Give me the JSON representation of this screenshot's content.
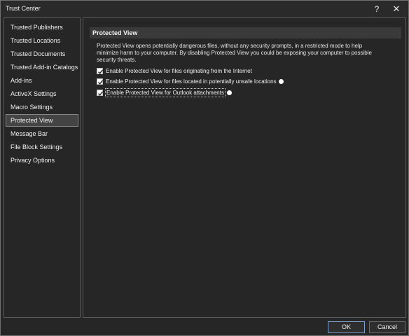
{
  "window": {
    "title": "Trust Center",
    "help_label": "?",
    "close_label": "✕"
  },
  "sidebar": {
    "items": [
      {
        "label": "Trusted Publishers",
        "selected": false
      },
      {
        "label": "Trusted Locations",
        "selected": false
      },
      {
        "label": "Trusted Documents",
        "selected": false
      },
      {
        "label": "Trusted Add-in Catalogs",
        "selected": false
      },
      {
        "label": "Add-ins",
        "selected": false
      },
      {
        "label": "ActiveX Settings",
        "selected": false
      },
      {
        "label": "Macro Settings",
        "selected": false
      },
      {
        "label": "Protected View",
        "selected": true
      },
      {
        "label": "Message Bar",
        "selected": false
      },
      {
        "label": "File Block Settings",
        "selected": false
      },
      {
        "label": "Privacy Options",
        "selected": false
      }
    ]
  },
  "main": {
    "section_title": "Protected View",
    "description": "Protected View opens potentially dangerous files, without any security prompts, in a restricted mode to help minimize harm to your computer. By disabling Protected View you could be exposing your computer to possible security threats.",
    "options": [
      {
        "label": "Enable Protected View for files originating from the Internet",
        "checked": true,
        "info": false
      },
      {
        "label": "Enable Protected View for files located in potentially unsafe locations",
        "checked": true,
        "info": true
      },
      {
        "label": "Enable Protected View for Outlook attachments",
        "checked": true,
        "info": true
      }
    ]
  },
  "footer": {
    "ok_label": "OK",
    "cancel_label": "Cancel"
  },
  "colors": {
    "background": "#262626",
    "selected_item": "#444444",
    "accent_border": "#7f9fcf"
  },
  "icons": {
    "help": "question-mark-icon",
    "close": "close-icon",
    "info": "info-icon",
    "check": "checkmark-icon"
  }
}
